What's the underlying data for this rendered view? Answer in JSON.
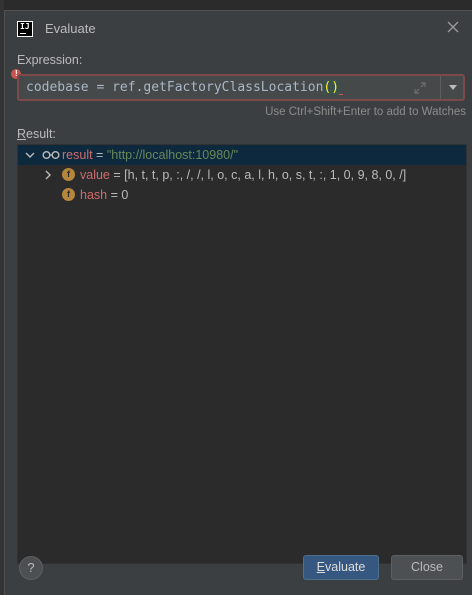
{
  "window": {
    "title": "Evaluate",
    "app_icon_text": "IJ"
  },
  "expression": {
    "label": "Expression:",
    "value_main": "codebase = ref.getFactoryClassLocation",
    "value_parens": "()",
    "hint": "Use Ctrl+Shift+Enter to add to Watches"
  },
  "result": {
    "label_first": "R",
    "label_rest": "esult:",
    "rows": [
      {
        "name": "result",
        "op": " = ",
        "value": "\"http://localhost:10980/\"",
        "icon": "watch-glasses-icon",
        "expanded": true
      },
      {
        "name": "value",
        "op": " = ",
        "value": "[h, t, t, p, :, /, /, l, o, c, a, l, h, o, s, t, :, 1, 0, 9, 8, 0, /]",
        "icon": "field-icon",
        "icon_letter": "f",
        "expanded": false
      },
      {
        "name": "hash",
        "op": " = ",
        "value": "0",
        "icon": "field-icon",
        "icon_letter": "f"
      }
    ]
  },
  "buttons": {
    "help": "?",
    "evaluate_first": "E",
    "evaluate_rest": "valuate",
    "close": "Close"
  },
  "colors": {
    "dialog_bg": "#3c3f41",
    "selection_bg": "#0d293e",
    "error_border": "#7c4a4a",
    "string_value": "#6a8759",
    "field_name": "#cf6b6b",
    "primary_button": "#365880"
  }
}
